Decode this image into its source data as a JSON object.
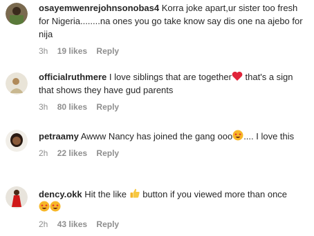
{
  "comments": [
    {
      "username": "osayemwenrejohnsonobas4",
      "text": "Korra joke apart,ur sister too fresh for Nigeria........na ones you go take know say dis one na ajebo for nija",
      "time": "3h",
      "likes": "19 likes",
      "reply": "Reply"
    },
    {
      "username": "officialruthmere",
      "text_before": "I love siblings that are together",
      "text_after": " that's a sign that shows they have gud parents",
      "emoji": "red-heart",
      "time": "3h",
      "likes": "80 likes",
      "reply": "Reply"
    },
    {
      "username": "petraamy",
      "text_before": "Awww Nancy has joined the gang ooo",
      "text_after": ".... I love this",
      "emoji": "star-struck",
      "time": "2h",
      "likes": "22 likes",
      "reply": "Reply"
    },
    {
      "username": "dency.okk",
      "text_before": "Hit the like",
      "text_after": " button if you viewed more than once",
      "emoji": "thumbs-up",
      "emoji_trailing": "star-struck x2",
      "time": "2h",
      "likes": "43 likes",
      "reply": "Reply"
    }
  ]
}
